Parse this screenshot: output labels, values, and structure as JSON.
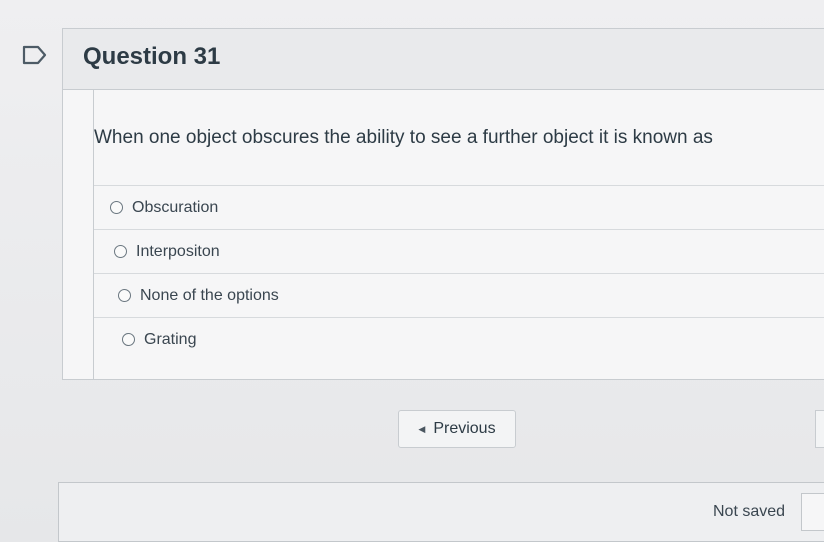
{
  "question": {
    "title": "Question 31",
    "text": "When one object obscures the ability to see a further object it is known as"
  },
  "answers": [
    {
      "label": "Obscuration",
      "selected": false
    },
    {
      "label": "Interpositon",
      "selected": false
    },
    {
      "label": "None of the options",
      "selected": false
    },
    {
      "label": "Grating",
      "selected": false
    }
  ],
  "navigation": {
    "previous_label": "Previous",
    "previous_icon": "triangle-left-icon"
  },
  "footer": {
    "status": "Not saved"
  },
  "icons": {
    "flag": "flag-outline-icon"
  }
}
